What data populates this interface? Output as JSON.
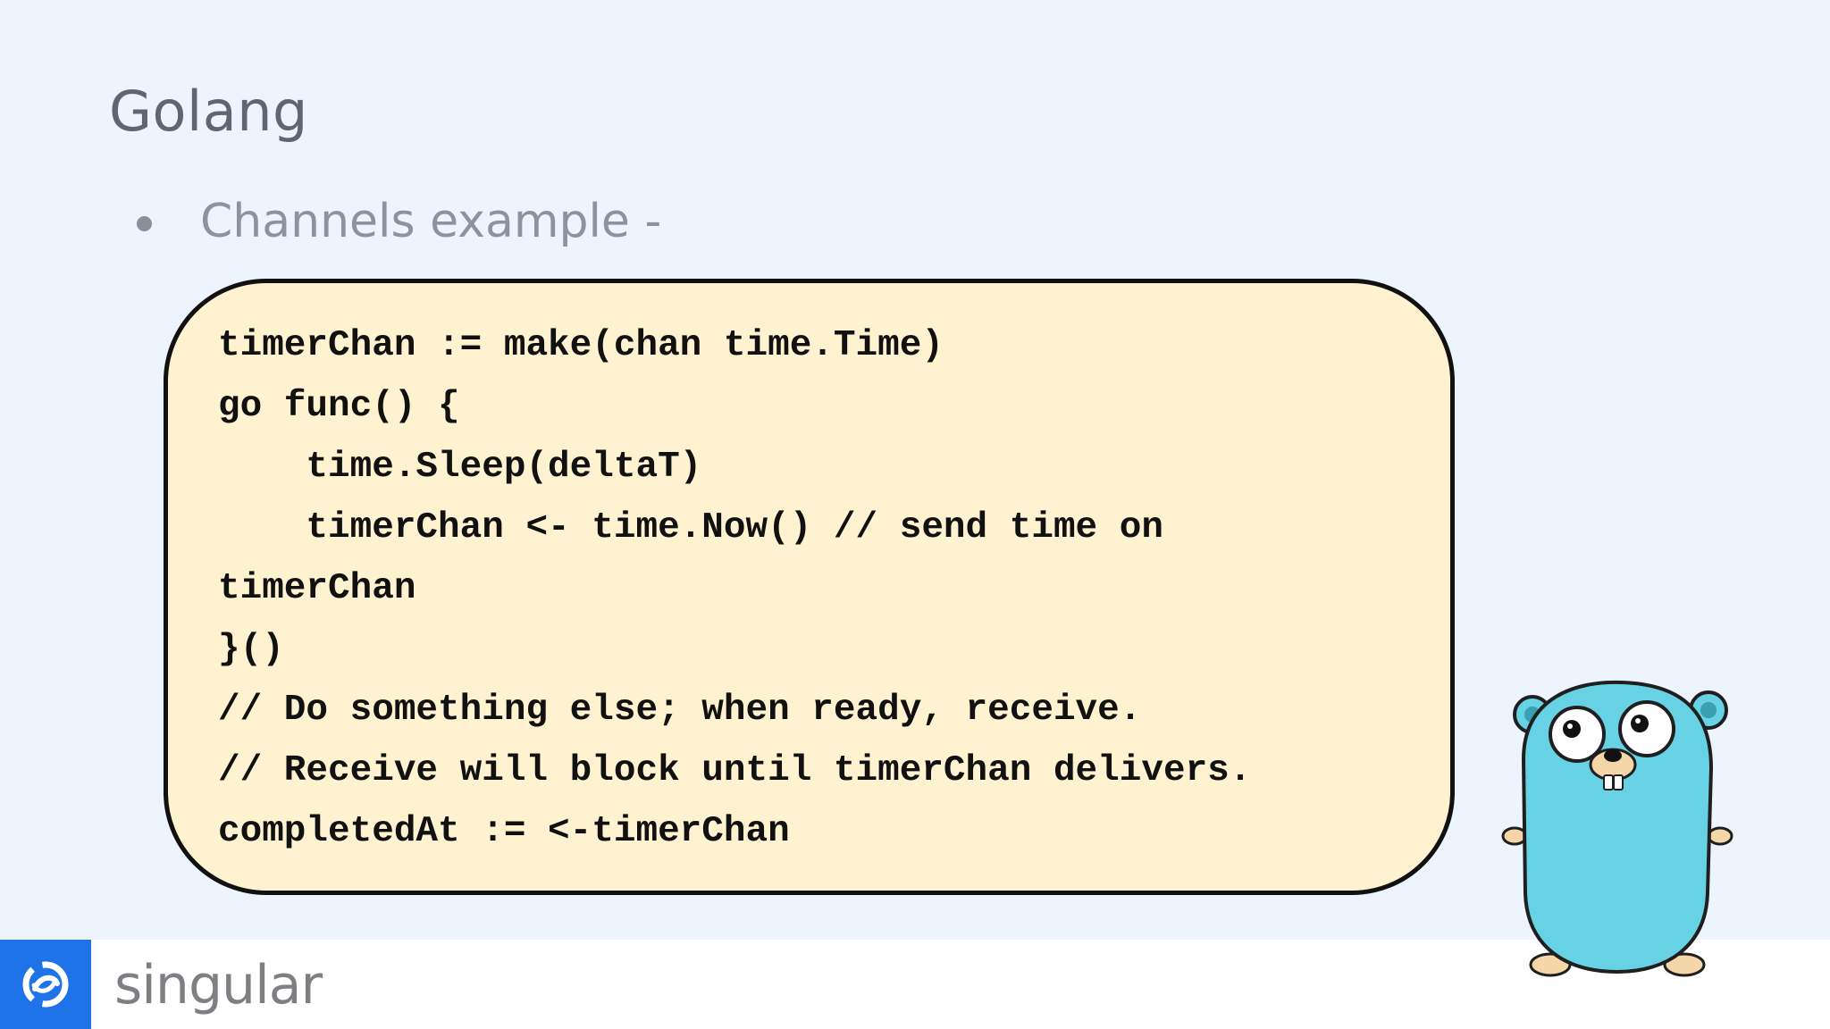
{
  "slide": {
    "title": "Golang",
    "bullet": "Channels example -"
  },
  "code": {
    "lines": [
      "timerChan := make(chan time.Time)",
      "go func() {",
      "    time.Sleep(deltaT)",
      "    timerChan <- time.Now() // send time on",
      "timerChan",
      "}()",
      "// Do something else; when ready, receive.",
      "// Receive will block until timerChan delivers.",
      "completedAt := <-timerChan"
    ]
  },
  "footer": {
    "brand": "singular",
    "logo_icon": "singular-logo-icon"
  },
  "mascot": {
    "icon": "go-gopher-mascot"
  },
  "colors": {
    "background": "#eef4fe",
    "code_background": "#fff2d1",
    "logo_blue": "#1e73e8",
    "gopher_blue": "#66d2e3"
  }
}
